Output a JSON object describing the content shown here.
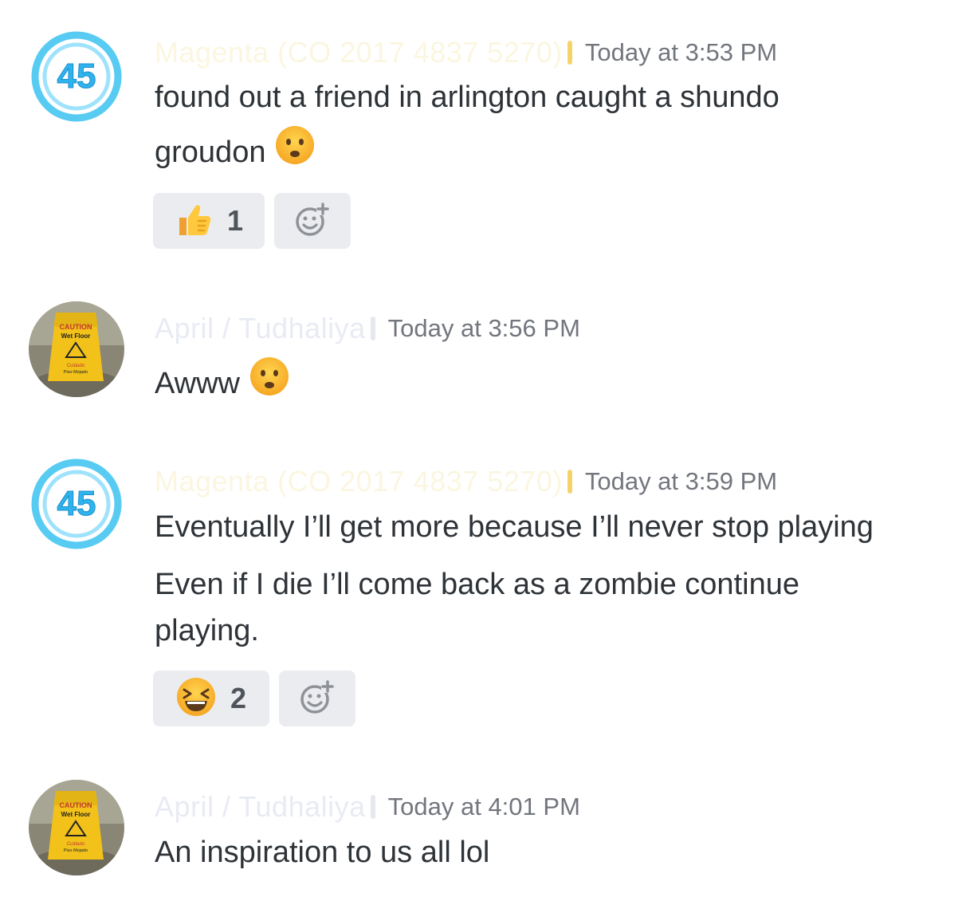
{
  "messages": [
    {
      "username": "Magenta (CO 2017 4837 5270)",
      "timestamp": "Today at 3:53 PM",
      "avatar_label": "45",
      "lines": [
        "found out a friend in arlington caught a shundo",
        "groudon"
      ],
      "trailing_emoji": "frowning-face",
      "reactions": [
        {
          "emoji": "thumbs-up",
          "count": "1"
        }
      ]
    },
    {
      "username": "April / Tudhaliya",
      "timestamp": "Today at 3:56 PM",
      "avatar_sign": {
        "line1": "CAUTION",
        "line2": "Wet Floor",
        "line3": "Cuidado",
        "line4": "Piso Mojado"
      },
      "lines": [
        "Awww"
      ],
      "trailing_emoji": "frowning-face"
    },
    {
      "username": "Magenta (CO 2017 4837 5270)",
      "timestamp": "Today at 3:59 PM",
      "avatar_label": "45",
      "lines": [
        "Eventually I’ll get more because I’ll never stop playing",
        "Even if I die I’ll come back as a zombie continue",
        "playing."
      ],
      "reactions": [
        {
          "emoji": "laughing-face",
          "count": "2"
        }
      ]
    },
    {
      "username": "April / Tudhaliya",
      "timestamp": "Today at 4:01 PM",
      "avatar_sign": {
        "line1": "CAUTION",
        "line2": "Wet Floor",
        "line3": "Cuidado",
        "line4": "Piso Mojado"
      },
      "lines": [
        "An inspiration to us all lol"
      ]
    }
  ],
  "colors": {
    "text": "#2e3338",
    "timestamp": "#72767d",
    "reaction_bg": "#ebecef",
    "avatar_ring": "#39c2f0",
    "sign_yellow": "#f2c21b"
  }
}
